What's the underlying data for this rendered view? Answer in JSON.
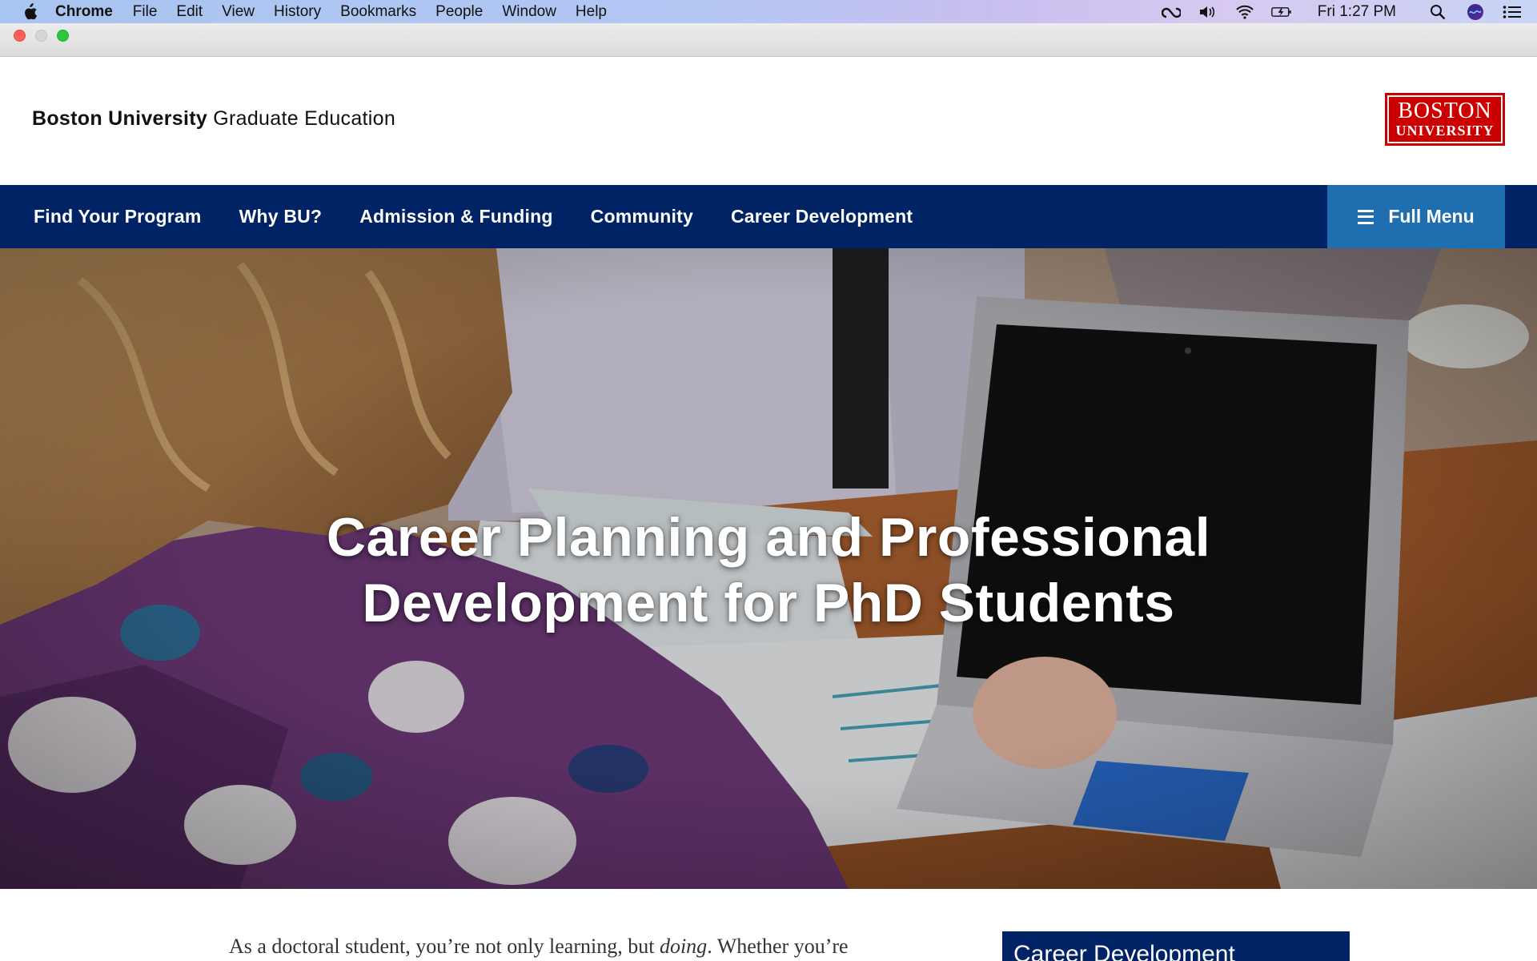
{
  "menubar": {
    "app_name": "Chrome",
    "items": [
      "File",
      "Edit",
      "View",
      "History",
      "Bookmarks",
      "People",
      "Window",
      "Help"
    ],
    "clock": "Fri 1:27 PM",
    "status_icons": [
      "creative-cloud-icon",
      "volume-icon",
      "wifi-icon",
      "battery-charging-icon",
      "spotlight-search-icon",
      "siri-icon",
      "notification-center-icon"
    ]
  },
  "site": {
    "title_strong": "Boston University",
    "title_rest": " Graduate Education",
    "logo_line1": "BOSTON",
    "logo_line2": "UNIVERSITY",
    "logo_color": "#cc0000"
  },
  "nav": {
    "links": [
      "Find Your Program",
      "Why BU?",
      "Admission & Funding",
      "Community",
      "Career Development"
    ],
    "full_menu_label": "Full Menu",
    "background": "#002366",
    "full_menu_background": "#1f6fb0"
  },
  "hero": {
    "title_line1": "Career Planning and Professional",
    "title_line2": "Development for PhD Students"
  },
  "content": {
    "intro_before": "As a doctoral student, you’re not only learning, but ",
    "intro_em": "doing",
    "intro_after": ". Whether you’re",
    "side_box_title": "Career Development"
  }
}
